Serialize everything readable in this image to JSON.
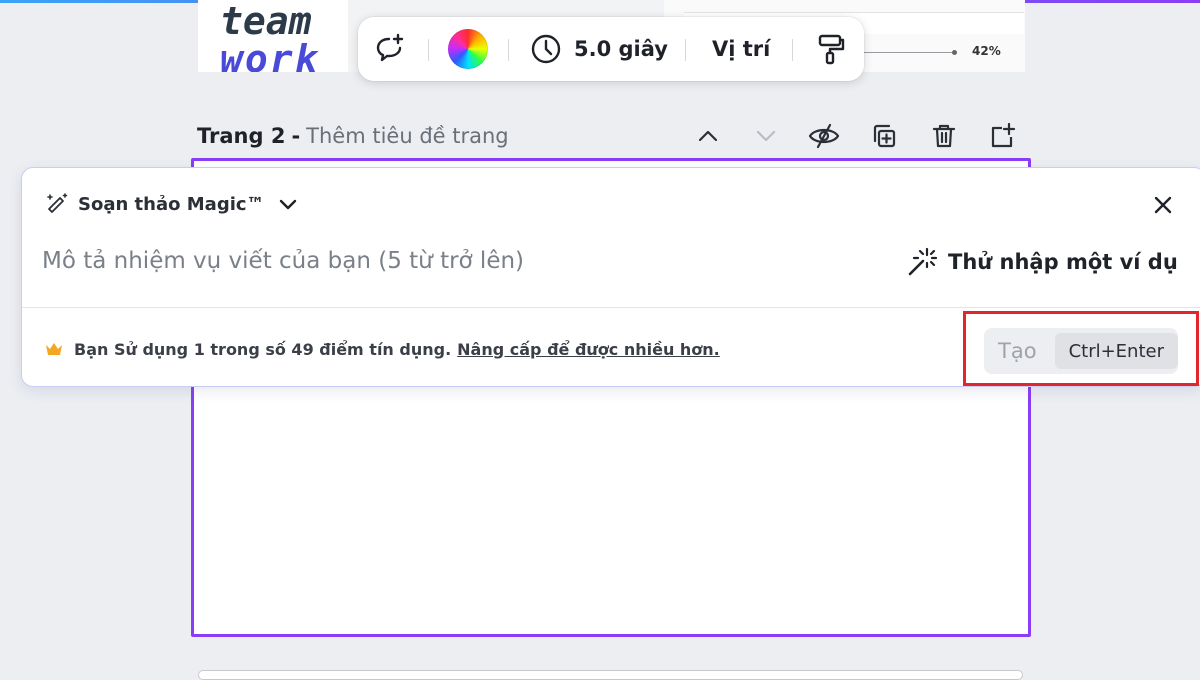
{
  "colors": {
    "accent_purple": "#8b3df5",
    "highlight_red": "#e3262c",
    "crown_gold": "#f5a623"
  },
  "previous_page": {
    "thumbnail_text_line1": "team",
    "thumbnail_text_line2": "work",
    "zoom_percent": "42%"
  },
  "toolbar": {
    "items": [
      {
        "icon": "add-comment-icon"
      },
      {
        "icon": "color-wheel-icon"
      },
      {
        "icon": "clock-icon",
        "label": "5.0 giây"
      },
      {
        "label": "Vị trí"
      },
      {
        "icon": "paint-roller-icon"
      }
    ]
  },
  "page_header": {
    "page_number": "Trang 2",
    "separator": " - ",
    "title_placeholder": "Thêm tiêu đề trang",
    "icons": [
      "chevron-up-icon",
      "chevron-down-icon",
      "eye-hide-icon",
      "duplicate-page-icon",
      "trash-icon",
      "add-page-icon"
    ]
  },
  "magic_write": {
    "title": "Soạn thảo Magic™",
    "prompt_placeholder": "Mô tả nhiệm vụ viết của bạn (5 từ trở lên)",
    "prompt_value": "",
    "example_button": "Thử nhập một ví dụ",
    "credits_text": "Bạn Sử dụng 1 trong số 49 điểm tín dụng.",
    "upgrade_link": "Nâng cấp để được nhiều hơn.",
    "generate_label": "Tạo",
    "shortcut": "Ctrl+Enter"
  }
}
